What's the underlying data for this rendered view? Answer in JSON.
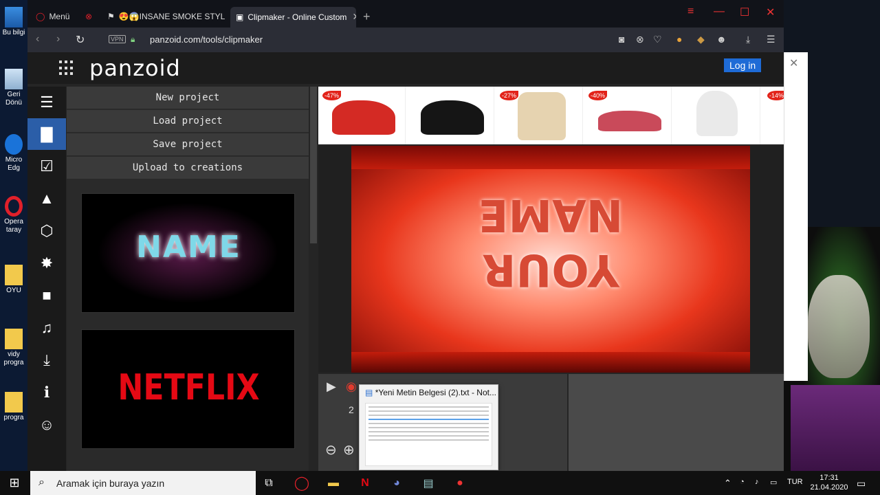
{
  "desktop": {
    "icons": [
      {
        "label": "Bu bilgi"
      },
      {
        "label": "Geri Dönü"
      },
      {
        "label": "Micro Edg"
      },
      {
        "label": "Opera taray"
      },
      {
        "label": "OYU"
      },
      {
        "label": "vidy progra"
      },
      {
        "label": "progra"
      }
    ]
  },
  "browser": {
    "tabs": [
      {
        "label": "Menü"
      },
      {
        "label": ""
      },
      {
        "label": "😍😱INSANE SMOKE STYL"
      },
      {
        "label": "Clipmaker - Online Custom"
      }
    ],
    "vpn_label": "VPN",
    "url": "panzoid.com/tools/clipmaker"
  },
  "page": {
    "logo": "panzoid",
    "login_label": "Log in",
    "menu": {
      "items": [
        "New project",
        "Load project",
        "Save project",
        "Upload to creations"
      ]
    },
    "templates": [
      {
        "title": "NAME"
      },
      {
        "title": "NETFLIX"
      }
    ],
    "ads": [
      {
        "discount": "-47%",
        "color": "#d42a24"
      },
      {
        "discount": "",
        "color": "#151515"
      },
      {
        "discount": "-27%",
        "color": "#e6d3b0"
      },
      {
        "discount": "-40%",
        "color": "#c94a5a"
      },
      {
        "discount": "",
        "color": "#f1f1f1"
      },
      {
        "discount": "-14%",
        "color": "#e23b2e"
      }
    ],
    "preview": {
      "line1": "NAME",
      "line2": "YOUR"
    },
    "timeline": {
      "time_label": "2"
    },
    "tooltip_title": "*Yeni Metin Belgesi (2).txt - Not..."
  },
  "taskbar": {
    "search_placeholder": "Aramak için buraya yazın",
    "language": "TUR",
    "time": "17:31",
    "date": "21.04.2020"
  },
  "colors": {
    "accent": "#2b5ea8",
    "login": "#1e6bd6",
    "preview_red": "#e8361c"
  }
}
